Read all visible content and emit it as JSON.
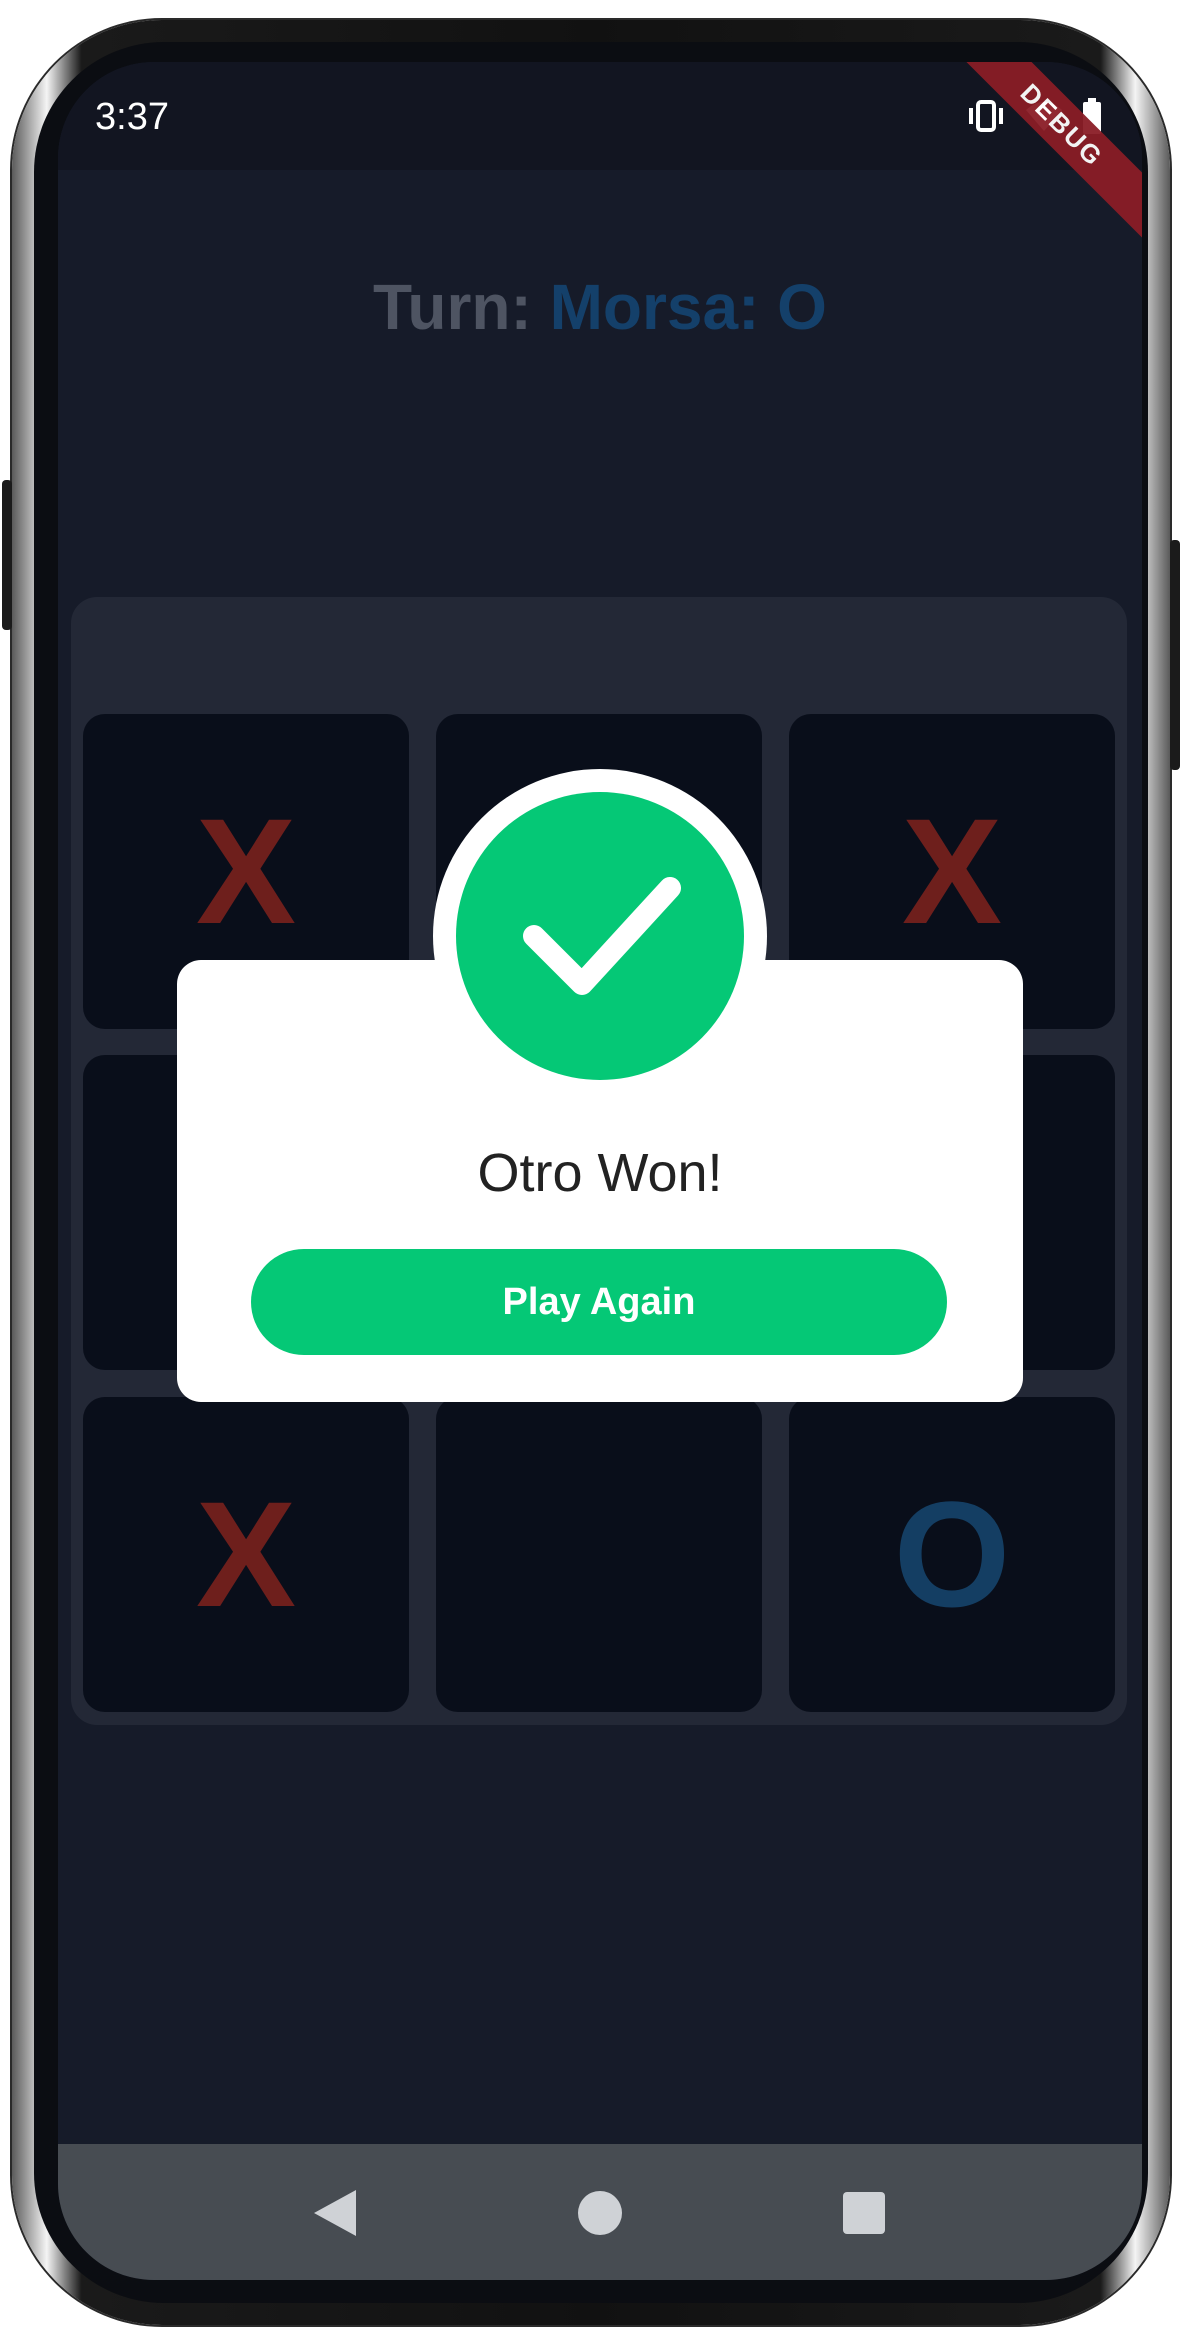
{
  "status_bar": {
    "time": "3:37",
    "icons": [
      "vibrate-icon",
      "wifi-icon",
      "battery-icon"
    ],
    "debug_banner": "DEBUG"
  },
  "header": {
    "turn_label": "Turn:",
    "turn_value": "Morsa: O"
  },
  "board": {
    "cells": [
      "X",
      "",
      "X",
      "",
      "",
      "",
      "X",
      "",
      "O"
    ]
  },
  "dialog": {
    "icon": "check-icon",
    "title": "Otro Won!",
    "button_label": "Play Again"
  },
  "nav_bar": {
    "buttons": [
      "back-icon",
      "home-icon",
      "recents-icon"
    ]
  },
  "colors": {
    "background": "#161b29",
    "cell": "#090e1a",
    "x_mark": "#6e1f1c",
    "o_mark": "#143e63",
    "accent_green": "#05c876",
    "dialog_bg": "#ffffff"
  }
}
